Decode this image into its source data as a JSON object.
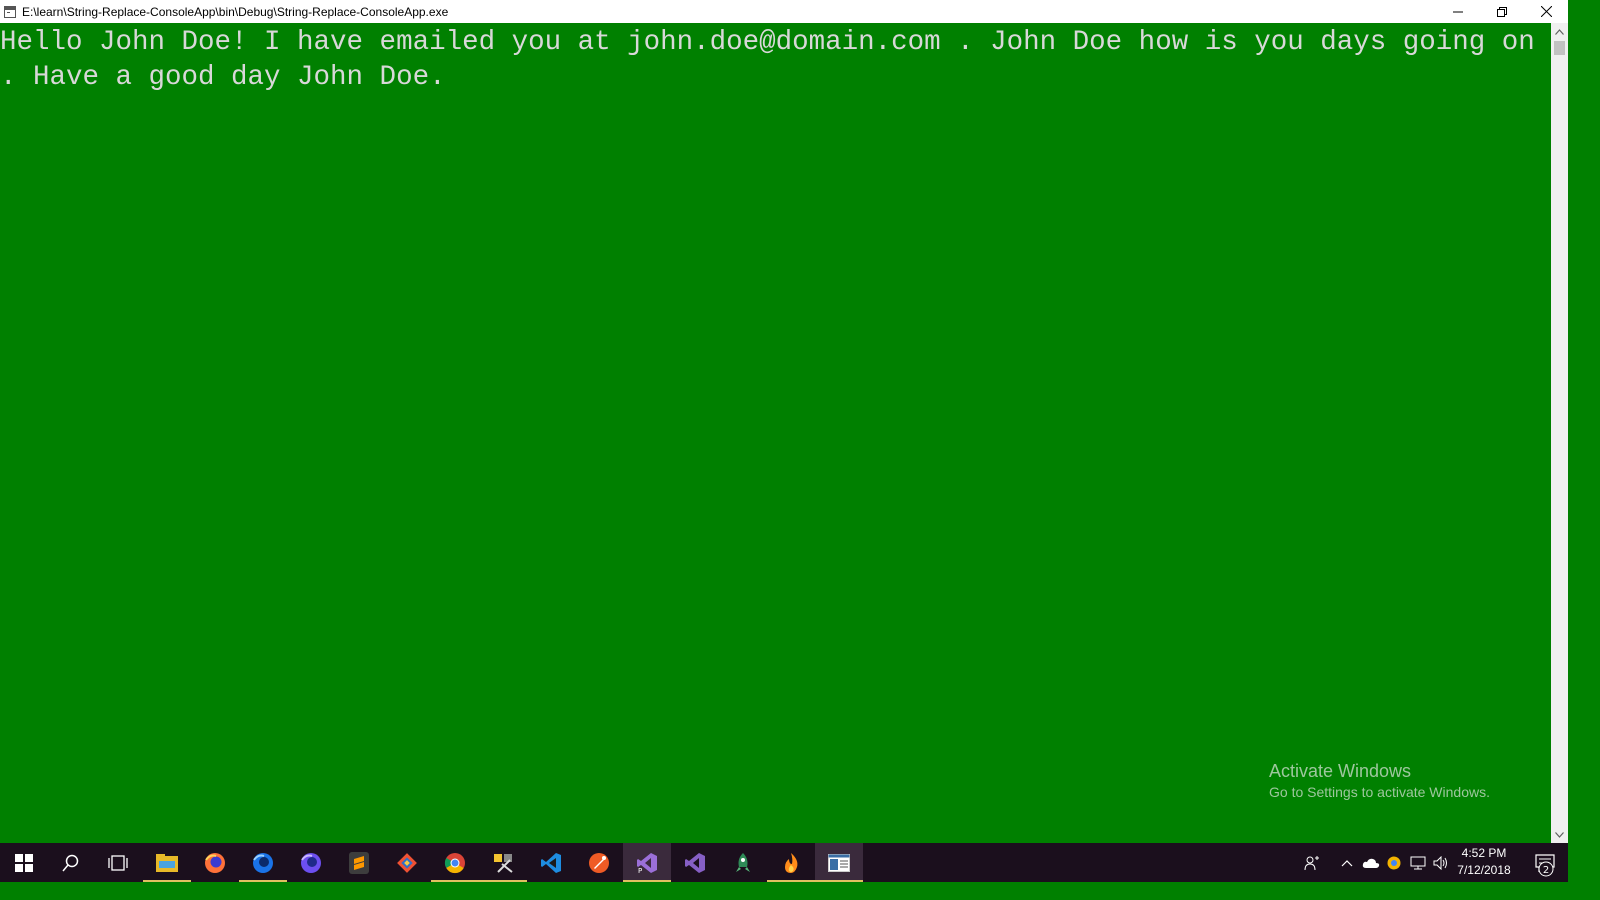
{
  "window": {
    "title": "E:\\learn\\String-Replace-ConsoleApp\\bin\\Debug\\String-Replace-ConsoleApp.exe",
    "controls": [
      "minimize-icon",
      "restore-icon",
      "close-icon"
    ]
  },
  "console": {
    "lines": [
      "Hello John Doe! I have emailed you at john.doe@domain.com . John Doe how is you days going on",
      ". Have a good day John Doe."
    ],
    "colors": {
      "background": "#008000",
      "text": "#d8d8d8"
    }
  },
  "watermark": {
    "title": "Activate Windows",
    "subtitle": "Go to Settings to activate Windows."
  },
  "taskbar": {
    "apps": [
      "windows-start-icon",
      "search-icon",
      "task-view-icon",
      "file-explorer-icon",
      "firefox-icon",
      "firefox-developer-icon",
      "firefox-nightly-icon",
      "sublime-text-icon",
      "git-icon",
      "chrome-icon",
      "tools-icon",
      "vscode-icon",
      "postman-icon",
      "visual-studio-preview-icon",
      "visual-studio-icon",
      "rocket-icon",
      "fire-icon",
      "console-app-icon"
    ],
    "tray": [
      "people-icon",
      "chevron-up-icon",
      "onedrive-icon",
      "chrome-tray-icon",
      "network-icon",
      "volume-icon"
    ],
    "clock": {
      "time": "4:52 PM",
      "date": "7/12/2018"
    },
    "notifications": {
      "count": "2"
    }
  }
}
